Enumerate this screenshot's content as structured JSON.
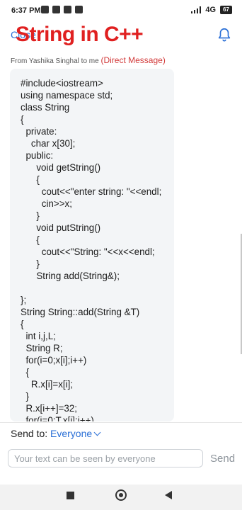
{
  "status_bar": {
    "time": "6:37 PM",
    "network": "4G",
    "battery": "67"
  },
  "header": {
    "close_label": "Close",
    "overlay_title": "String in C++"
  },
  "message": {
    "from_text": "From Yashika Singhal to me",
    "type_label": "(Direct Message)",
    "code": "#include<iostream>\nusing namespace std;\nclass String\n{\n  private:\n    char x[30];\n  public:\n      void getString()\n      {\n        cout<<\"enter string: \"<<endl;\n        cin>>x;\n      }\n      void putString()\n      {\n        cout<<\"String: \"<<x<<endl;\n      }\n      String add(String&);\n\n};\nString String::add(String &T)\n{\n  int i,j,L;\n  String R;\n  for(i=0;x[i];i++)\n  {\n    R.x[i]=x[i];\n  }\n  R.x[i++]=32;\n  for(j=0;T.x[j];j++)"
  },
  "compose": {
    "send_to_label": "Send to:",
    "send_to_value": "Everyone",
    "placeholder": "Your text can be seen by everyone",
    "send_label": "Send"
  },
  "icons": {
    "bell": "bell-icon",
    "chevron": "chevron-down-icon",
    "back": "nav-back-icon",
    "home": "nav-home-icon",
    "recent": "nav-recent-icon"
  },
  "colors": {
    "accent": "#2a6fd6",
    "overlay_red": "#e02020",
    "dm_red": "#d23a3a"
  }
}
